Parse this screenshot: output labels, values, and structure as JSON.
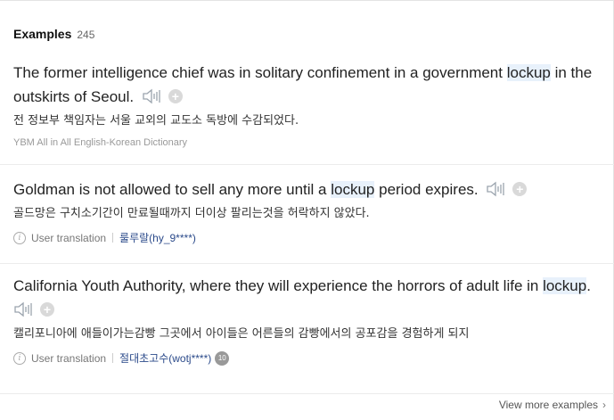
{
  "header": {
    "title": "Examples",
    "count": "245"
  },
  "examples": [
    {
      "pre": "The former intelligence chief was in solitary confinement in a government ",
      "keyword": "lockup",
      "post": " in the outskirts of Seoul.",
      "korean": "전 정보부 책임자는 서울 교외의 교도소 독방에 수감되었다.",
      "source": "YBM All in All English-Korean Dictionary"
    },
    {
      "pre": "Goldman is not allowed to sell any more until a ",
      "keyword": "lockup",
      "post": " period expires.",
      "korean": "골드망은 구치소기간이 만료될때까지 더이상 팔리는것을 허락하지 않았다.",
      "meta_label": "User translation",
      "user": "룰루랄(hy_9****)"
    },
    {
      "pre": "California Youth Authority, where they will experience the horrors of adult life in ",
      "keyword": "lockup",
      "post": ".",
      "korean": "캘리포니아에 애들이가는감빵 그곳에서 아이들은 어른들의 감빵에서의 공포감을 경험하게 되지",
      "meta_label": "User translation",
      "user": "절대초고수(wotj****)",
      "badge": "10"
    }
  ],
  "footer": {
    "label": "View more examples"
  },
  "colors": {
    "highlight": "#e8f1fb",
    "link": "#2b4a8a"
  },
  "icons": {
    "speaker": "speaker-icon",
    "add": "plus-icon",
    "info": "info-icon",
    "chevron": "chevron-right-icon"
  }
}
